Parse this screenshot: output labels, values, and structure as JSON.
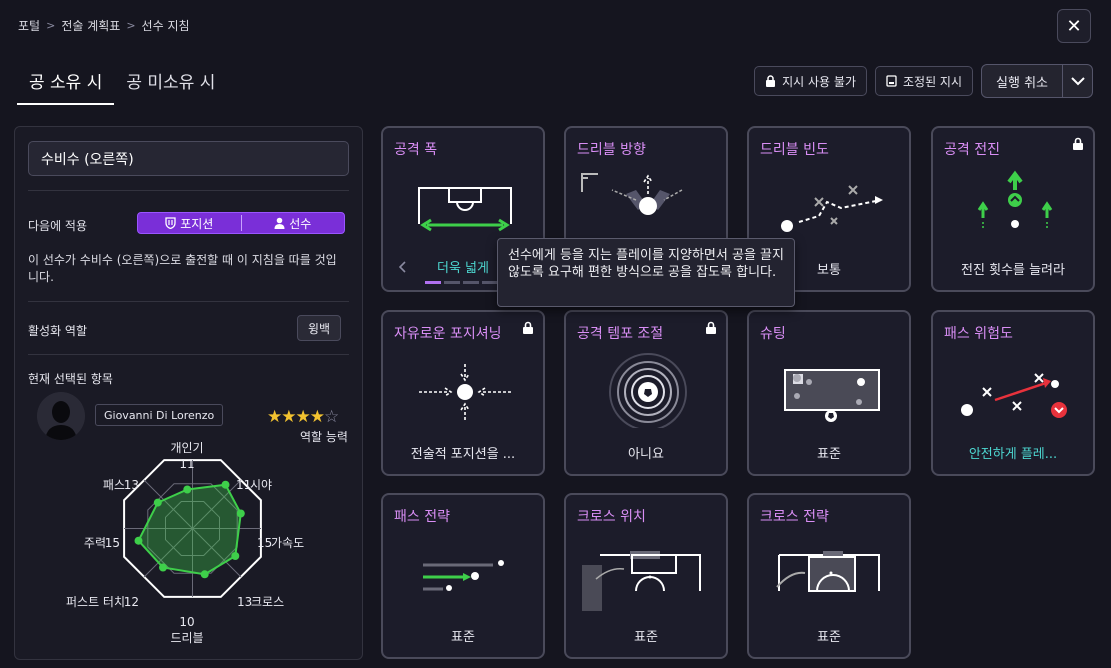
{
  "breadcrumb": {
    "item1": "포털",
    "item2": "전술 계획표",
    "item3": "선수 지침"
  },
  "tabs": [
    {
      "label": "공 소유 시"
    },
    {
      "label": "공 미소유 시"
    }
  ],
  "actions": {
    "unavailable": "지시 사용 불가",
    "adjusted": "조정된 지시",
    "undo": "실행 취소"
  },
  "left": {
    "role": "수비수 (오른쪽)",
    "apply_label": "다음에 적용",
    "apply_position": "포지션",
    "apply_player": "선수",
    "description": "이 선수가 수비수 (오른쪽)으로 출전할 때 이 지침을 따를 것입니다.",
    "active_role_label": "활성화 역할",
    "active_role_value": "윙백",
    "selected_label": "현재 선택된 항목",
    "player_name": "Giovanni Di Lorenzo",
    "rating_stars": 3.5,
    "role_ability": "역할 능력"
  },
  "radar": {
    "stats": [
      {
        "label": "개인기",
        "value": "11"
      },
      {
        "label": "시야",
        "value": "11"
      },
      {
        "label": "가속도",
        "value": "15"
      },
      {
        "label": "크로스",
        "value": "13"
      },
      {
        "label": "드리블",
        "value": "10"
      },
      {
        "label": "퍼스트 터치",
        "value": "12"
      },
      {
        "label": "주력",
        "value": "15"
      },
      {
        "label": "패스",
        "value": "13"
      }
    ]
  },
  "cards": [
    {
      "title": "공격 폭",
      "value": "더욱 넓게"
    },
    {
      "title": "드리블 방향",
      "value": ""
    },
    {
      "title": "드리블 빈도",
      "value": "보통"
    },
    {
      "title": "공격 전진",
      "value": "전진 횟수를 늘려라"
    },
    {
      "title": "자유로운 포지셔닝",
      "value": "전술적 포지션을 ..."
    },
    {
      "title": "공격 템포 조절",
      "value": "아니요"
    },
    {
      "title": "슈팅",
      "value": "표준"
    },
    {
      "title": "패스 위험도",
      "value": "안전하게 플레..."
    },
    {
      "title": "패스 전략",
      "value": "표준"
    },
    {
      "title": "크로스 위치",
      "value": "표준"
    },
    {
      "title": "크로스 전략",
      "value": "표준"
    }
  ],
  "tooltip": "선수에게 등을 지는 플레이를 지양하면서 공을 끌지 않도록 요구해 편한 방식으로 공을 잡도록 합니다.",
  "colors": {
    "accent_purple": "#7a2fd8",
    "title_pink": "#d98ef5",
    "teal": "#4dd6d0",
    "green": "#3ecf4a"
  }
}
